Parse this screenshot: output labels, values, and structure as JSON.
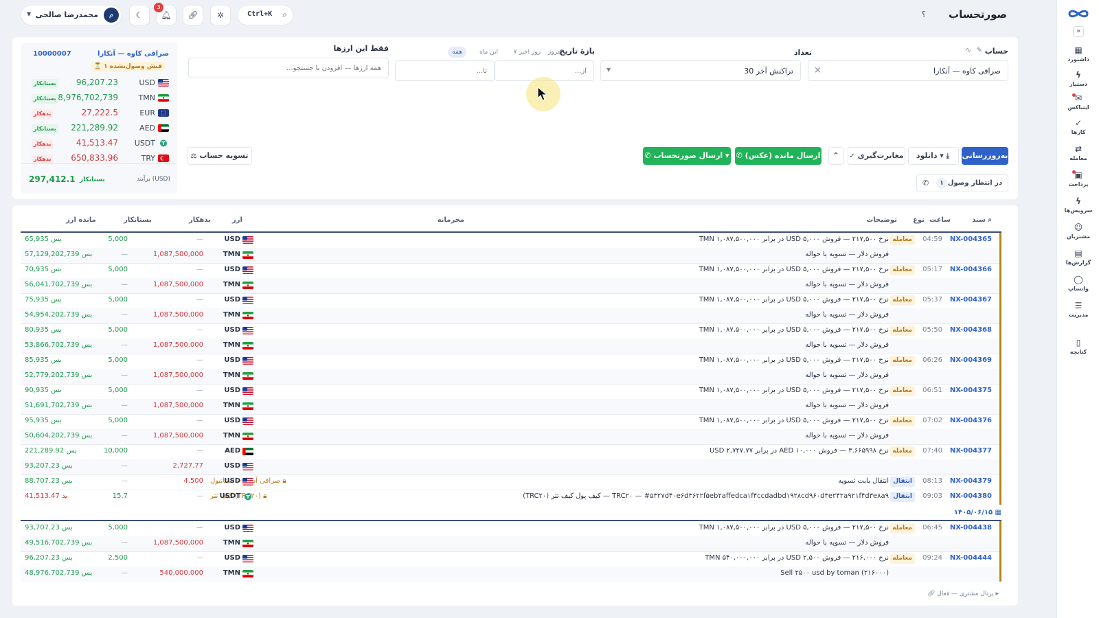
{
  "header": {
    "page_title": "صورتحساب",
    "help": "؟",
    "user_name": "محمدرضا صالحی",
    "user_initial": "م",
    "search_shortcut": "Ctrl+K",
    "notif_count": "3"
  },
  "nav": [
    {
      "label": "داشبورد",
      "icon": "grid-icon"
    },
    {
      "label": "دستیار",
      "icon": "bolt-icon"
    },
    {
      "label": "ایتباکس",
      "icon": "inbox-icon"
    },
    {
      "label": "کارها",
      "icon": "check-icon"
    },
    {
      "label": "معامله",
      "icon": "exchange-icon"
    },
    {
      "label": "پرداخت",
      "icon": "wallet-icon"
    },
    {
      "label": "سرویس‌ها",
      "icon": "flash-icon"
    },
    {
      "label": "مشتریان",
      "icon": "users-icon"
    },
    {
      "label": "گزارش‌ها",
      "icon": "report-icon"
    },
    {
      "label": "واتساپ",
      "icon": "chat-icon"
    },
    {
      "label": "مدیریت",
      "icon": "sliders-icon"
    },
    {
      "label": "کتابچه",
      "icon": "book-icon"
    }
  ],
  "filters": {
    "account_label": "حساب",
    "account_value": "صرافی کاوه — آنکارا",
    "count_label": "تعداد",
    "count_value": "30 تراکنش آخر",
    "date_label": "بازهٔ تاریخ",
    "date_chips": [
      "همه",
      "این ماه",
      "۷ روز اخیر",
      "امروز"
    ],
    "date_from_ph": "از...",
    "date_to_ph": "تا...",
    "currencies_label": "فقط این ارزها",
    "currencies_ph": "همه ارزها — افزودن با جستجو..."
  },
  "actions": {
    "refresh": "به‌روزرسانی",
    "download": "دانلود ▾",
    "reconcile": "مغایرت‌گیری",
    "send_balance": "ارسال مانده (عکس)",
    "send_statement": "ارسال صورتحساب ▾",
    "settle": "تسویه حساب",
    "pending_label": "در انتظار وصول",
    "pending_count": "۱"
  },
  "balance": {
    "account_name": "صرافی کاوه — آنکارا",
    "account_no": "10000007",
    "unreceived": "۱ فیش وصول‌نشده",
    "rows": [
      {
        "ccy": "USD",
        "amount": "96,207.23",
        "status": "بستانکار"
      },
      {
        "ccy": "TMN",
        "amount": "48,976,702,739",
        "status": "بستانکار"
      },
      {
        "ccy": "EUR",
        "amount": "27,222.5",
        "status": "بدهکار"
      },
      {
        "ccy": "AED",
        "amount": "221,289.92",
        "status": "بستانکار"
      },
      {
        "ccy": "USDT",
        "amount": "41,513.47",
        "status": "بدهکار"
      },
      {
        "ccy": "TRY",
        "amount": "650,833.96",
        "status": "بدهکار"
      }
    ],
    "total_label": "برآیند (USD)",
    "total_amount": "297,412.1",
    "total_status": "بستانکار"
  },
  "table": {
    "headers": {
      "doc": "سند",
      "time": "ساعت",
      "type": "نوع",
      "desc": "توضیحات",
      "confidential": "محرمانه",
      "ccy": "ارز",
      "debit": "بدهکار",
      "credit": "بستانکار",
      "balance": "مانده ارز"
    },
    "rows": [
      {
        "doc": "NX-004365",
        "time": "04:59",
        "type": "معامله",
        "desc": "نرخ ۲۱۷,۵۰۰ — فروش ۵,۰۰۰ USD در برابر ۱,۰۸۷,۵۰۰,۰۰۰ TMN",
        "conf": "",
        "ccy": "USD",
        "debit": "—",
        "credit": "5,000",
        "bal": "بس 65,935"
      },
      {
        "doc": "",
        "time": "",
        "type": "",
        "desc": "فروش دلار — تسویه با حواله",
        "conf": "",
        "ccy": "TMN",
        "debit": "1,087,500,000",
        "credit": "—",
        "bal": "بس 57,129,202,739"
      },
      {
        "doc": "NX-004366",
        "time": "05:17",
        "type": "معامله",
        "desc": "نرخ ۲۱۷,۵۰۰ — فروش ۵,۰۰۰ USD در برابر ۱,۰۸۷,۵۰۰,۰۰۰ TMN",
        "conf": "",
        "ccy": "USD",
        "debit": "—",
        "credit": "5,000",
        "bal": "بس 70,935"
      },
      {
        "doc": "",
        "time": "",
        "type": "",
        "desc": "فروش دلار — تسویه با حواله",
        "conf": "",
        "ccy": "TMN",
        "debit": "1,087,500,000",
        "credit": "—",
        "bal": "بس 56,041,702,739"
      },
      {
        "doc": "NX-004367",
        "time": "05:37",
        "type": "معامله",
        "desc": "نرخ ۲۱۷,۵۰۰ — فروش ۵,۰۰۰ USD در برابر ۱,۰۸۷,۵۰۰,۰۰۰ TMN",
        "conf": "",
        "ccy": "USD",
        "debit": "—",
        "credit": "5,000",
        "bal": "بس 75,935"
      },
      {
        "doc": "",
        "time": "",
        "type": "",
        "desc": "فروش دلار — تسویه با حواله",
        "conf": "",
        "ccy": "TMN",
        "debit": "1,087,500,000",
        "credit": "—",
        "bal": "بس 54,954,202,739"
      },
      {
        "doc": "NX-004368",
        "time": "05:50",
        "type": "معامله",
        "desc": "نرخ ۲۱۷,۵۰۰ — فروش ۵,۰۰۰ USD در برابر ۱,۰۸۷,۵۰۰,۰۰۰ TMN",
        "conf": "",
        "ccy": "USD",
        "debit": "—",
        "credit": "5,000",
        "bal": "بس 80,935"
      },
      {
        "doc": "",
        "time": "",
        "type": "",
        "desc": "فروش دلار — تسویه با حواله",
        "conf": "",
        "ccy": "TMN",
        "debit": "1,087,500,000",
        "credit": "—",
        "bal": "بس 53,866,702,739"
      },
      {
        "doc": "NX-004369",
        "time": "06:26",
        "type": "معامله",
        "desc": "نرخ ۲۱۷,۵۰۰ — فروش ۵,۰۰۰ USD در برابر ۱,۰۸۷,۵۰۰,۰۰۰ TMN",
        "conf": "",
        "ccy": "USD",
        "debit": "—",
        "credit": "5,000",
        "bal": "بس 85,935"
      },
      {
        "doc": "",
        "time": "",
        "type": "",
        "desc": "فروش دلار — تسویه با حواله",
        "conf": "",
        "ccy": "TMN",
        "debit": "1,087,500,000",
        "credit": "—",
        "bal": "بس 52,779,202,739"
      },
      {
        "doc": "NX-004375",
        "time": "06:51",
        "type": "معامله",
        "desc": "نرخ ۲۱۷,۵۰۰ — فروش ۵,۰۰۰ USD در برابر ۱,۰۸۷,۵۰۰,۰۰۰ TMN",
        "conf": "",
        "ccy": "USD",
        "debit": "—",
        "credit": "5,000",
        "bal": "بس 90,935"
      },
      {
        "doc": "",
        "time": "",
        "type": "",
        "desc": "فروش دلار — تسویه با حواله",
        "conf": "",
        "ccy": "TMN",
        "debit": "1,087,500,000",
        "credit": "—",
        "bal": "بس 51,691,702,739"
      },
      {
        "doc": "NX-004376",
        "time": "07:02",
        "type": "معامله",
        "desc": "نرخ ۲۱۷,۵۰۰ — فروش ۵,۰۰۰ USD در برابر ۱,۰۸۷,۵۰۰,۰۰۰ TMN",
        "conf": "",
        "ccy": "USD",
        "debit": "—",
        "credit": "5,000",
        "bal": "بس 95,935"
      },
      {
        "doc": "",
        "time": "",
        "type": "",
        "desc": "فروش دلار — تسویه با حواله",
        "conf": "",
        "ccy": "TMN",
        "debit": "1,087,500,000",
        "credit": "—",
        "bal": "بس 50,604,202,739"
      },
      {
        "doc": "NX-004377",
        "time": "07:40",
        "type": "معامله",
        "desc": "نرخ ۳.۶۶۵۹۹۸ — فروش ۱۰,۰۰۰ AED در برابر ۲,۷۲۷.۷۷ USD",
        "conf": "",
        "ccy": "AED",
        "debit": "—",
        "credit": "10,000",
        "bal": "بس 221,289.92"
      },
      {
        "doc": "",
        "time": "",
        "type": "",
        "desc": "",
        "conf": "",
        "ccy": "USD",
        "debit": "2,727.77",
        "credit": "—",
        "bal": "بس 93,207.23"
      },
      {
        "doc": "NX-004379",
        "time": "08:13",
        "type": "انتقال",
        "desc": "انتقال بابت تسویه",
        "conf": "صرافی آسیا — استانبول",
        "ccy": "USD",
        "debit": "4,500",
        "credit": "—",
        "bal": "بس 88,707.23"
      },
      {
        "doc": "NX-004380",
        "time": "09:03",
        "type": "انتقال",
        "desc": "TRC۲۰ — #۵۳۲۷d۴۰e۶d۳۶۲۲f۵eb۲affedca۱f۴ccdadbd۱۹۲۸cd۹۶۰d۳e۲۴۲a۹۲۱f۴d۳e۸a۹ — کیف پول کیف تتر (TRC۲۰)",
        "conf": "کیف تتر (TRC۲۰)",
        "ccy": "USDT",
        "debit": "—",
        "credit": "15.7",
        "bal": "بد 41,513.47"
      },
      {
        "doc": "NX-004438",
        "time": "06:45",
        "type": "معامله",
        "desc": "نرخ ۲۱۷,۵۰۰ — فروش ۵,۰۰۰ USD در برابر ۱,۰۸۷,۵۰۰,۰۰۰ TMN",
        "conf": "",
        "ccy": "USD",
        "debit": "—",
        "credit": "5,000",
        "bal": "بس 93,707.23"
      },
      {
        "doc": "",
        "time": "",
        "type": "",
        "desc": "فروش دلار — تسویه با حواله",
        "conf": "",
        "ccy": "TMN",
        "debit": "1,087,500,000",
        "credit": "—",
        "bal": "بس 49,516,702,739"
      },
      {
        "doc": "NX-004444",
        "time": "09:24",
        "type": "معامله",
        "desc": "نرخ ۲۱۶,۰۰۰ — فروش ۲,۵۰۰ USD در برابر ۵۴۰,۰۰۰,۰۰۰ TMN",
        "conf": "",
        "ccy": "USD",
        "debit": "—",
        "credit": "2,500",
        "bal": "بس 96,207.23"
      },
      {
        "doc": "",
        "time": "",
        "type": "",
        "desc": "Sell ۲۵۰۰ usd by toman (۲۱۶۰۰۰)",
        "conf": "",
        "ccy": "TMN",
        "debit": "540,000,000",
        "credit": "—",
        "bal": "بس 48,976,702,739"
      }
    ],
    "date_group": "۱۴۰۵/۰۶/۱۵"
  },
  "footer": {
    "portal": "پرتال مشتری — فعال"
  },
  "colors": {
    "primary": "#2f62c9",
    "success": "#22b35a",
    "danger": "#d6373a",
    "accent": "#b8860b"
  }
}
